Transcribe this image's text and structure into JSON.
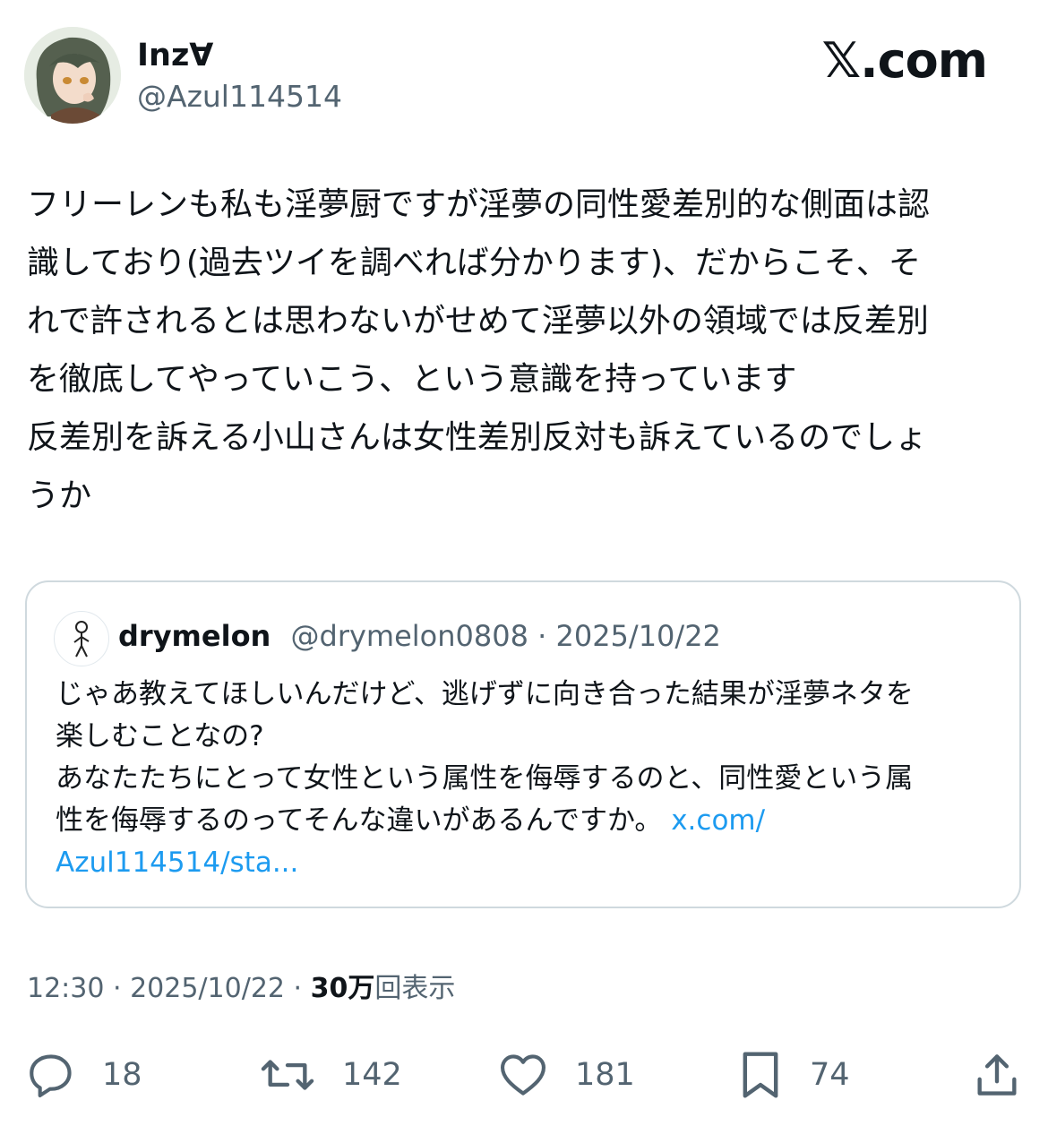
{
  "author": {
    "display_name": "Inz∀",
    "handle": "@Azul114514",
    "avatar_icon": "anime-character-avatar"
  },
  "brand": {
    "label": "𝕏.com"
  },
  "tweet": {
    "text": "フリーレンも私も淫夢厨ですが淫夢の同性愛差別的な側面は認\n識しており(過去ツイを調べれば分かります)、だからこそ、そ\nれで許されるとは思わないがせめて淫夢以外の領域では反差別\nを徹底してやっていこう、という意識を持っています\n反差別を訴える小山さんは女性差別反対も訴えているのでしょ\nうか"
  },
  "quote": {
    "name": "drymelon",
    "handle": "@drymelon0808",
    "separator": " · ",
    "date": "2025/10/22",
    "avatar_icon": "stick-figure-avatar",
    "text": "じゃあ教えてほしいんだけど、逃げずに向き合った結果が淫夢ネタを\n楽しむことなの?\nあなたたちにとって女性という属性を侮辱するのと、同性愛という属\n性を侮辱するのってそんな違いがあるんですか。 ",
    "link_part1": "x.com/",
    "link_part2": "Azul114514/sta..."
  },
  "meta": {
    "time": "12:30",
    "sep1": " · ",
    "date": "2025/10/22",
    "sep2": " · ",
    "views_count": "30万",
    "views_label": "回表示"
  },
  "actions": {
    "replies": "18",
    "reposts": "142",
    "likes": "181",
    "bookmarks": "74"
  },
  "colors": {
    "text": "#0f1419",
    "secondary": "#536471",
    "link": "#1d9bf0",
    "border": "#cfd9de"
  }
}
